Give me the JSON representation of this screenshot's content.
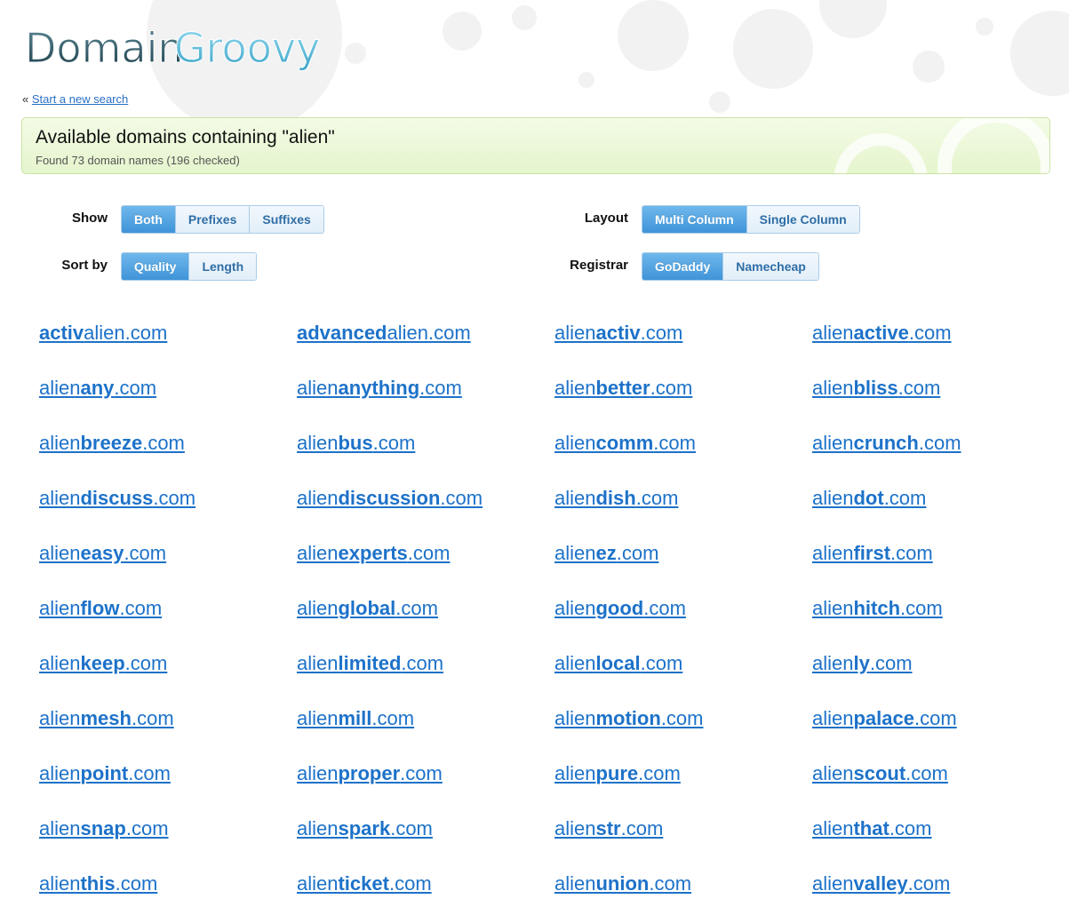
{
  "logo": {
    "text_dark": "Domain",
    "text_light": "Groovy"
  },
  "nav": {
    "back_prefix": "«",
    "back_link": "Start a new search"
  },
  "banner": {
    "title": "Available domains containing \"alien\"",
    "subtitle": "Found 73 domain names (196 checked)"
  },
  "controls": {
    "show": {
      "label": "Show",
      "options": [
        "Both",
        "Prefixes",
        "Suffixes"
      ],
      "selected": "Both"
    },
    "sort": {
      "label": "Sort by",
      "options": [
        "Quality",
        "Length"
      ],
      "selected": "Quality"
    },
    "layout": {
      "label": "Layout",
      "options": [
        "Multi Column",
        "Single Column"
      ],
      "selected": "Multi Column"
    },
    "registrar": {
      "label": "Registrar",
      "options": [
        "GoDaddy",
        "Namecheap"
      ],
      "selected": "GoDaddy"
    }
  },
  "domains": [
    {
      "pre": "activ",
      "kw": "alien",
      "post": "",
      "tld": ".com",
      "bold": "pre"
    },
    {
      "pre": "advanced",
      "kw": "alien",
      "post": "",
      "tld": ".com",
      "bold": "pre"
    },
    {
      "pre": "",
      "kw": "alien",
      "post": "activ",
      "tld": ".com",
      "bold": "post"
    },
    {
      "pre": "",
      "kw": "alien",
      "post": "active",
      "tld": ".com",
      "bold": "post"
    },
    {
      "pre": "",
      "kw": "alien",
      "post": "any",
      "tld": ".com",
      "bold": "post"
    },
    {
      "pre": "",
      "kw": "alien",
      "post": "anything",
      "tld": ".com",
      "bold": "post"
    },
    {
      "pre": "",
      "kw": "alien",
      "post": "better",
      "tld": ".com",
      "bold": "post"
    },
    {
      "pre": "",
      "kw": "alien",
      "post": "bliss",
      "tld": ".com",
      "bold": "post"
    },
    {
      "pre": "",
      "kw": "alien",
      "post": "breeze",
      "tld": ".com",
      "bold": "post"
    },
    {
      "pre": "",
      "kw": "alien",
      "post": "bus",
      "tld": ".com",
      "bold": "post"
    },
    {
      "pre": "",
      "kw": "alien",
      "post": "comm",
      "tld": ".com",
      "bold": "post"
    },
    {
      "pre": "",
      "kw": "alien",
      "post": "crunch",
      "tld": ".com",
      "bold": "post"
    },
    {
      "pre": "",
      "kw": "alien",
      "post": "discuss",
      "tld": ".com",
      "bold": "post"
    },
    {
      "pre": "",
      "kw": "alien",
      "post": "discussion",
      "tld": ".com",
      "bold": "post"
    },
    {
      "pre": "",
      "kw": "alien",
      "post": "dish",
      "tld": ".com",
      "bold": "post"
    },
    {
      "pre": "",
      "kw": "alien",
      "post": "dot",
      "tld": ".com",
      "bold": "post"
    },
    {
      "pre": "",
      "kw": "alien",
      "post": "easy",
      "tld": ".com",
      "bold": "post"
    },
    {
      "pre": "",
      "kw": "alien",
      "post": "experts",
      "tld": ".com",
      "bold": "post"
    },
    {
      "pre": "",
      "kw": "alien",
      "post": "ez",
      "tld": ".com",
      "bold": "post"
    },
    {
      "pre": "",
      "kw": "alien",
      "post": "first",
      "tld": ".com",
      "bold": "post"
    },
    {
      "pre": "",
      "kw": "alien",
      "post": "flow",
      "tld": ".com",
      "bold": "post"
    },
    {
      "pre": "",
      "kw": "alien",
      "post": "global",
      "tld": ".com",
      "bold": "post"
    },
    {
      "pre": "",
      "kw": "alien",
      "post": "good",
      "tld": ".com",
      "bold": "post"
    },
    {
      "pre": "",
      "kw": "alien",
      "post": "hitch",
      "tld": ".com",
      "bold": "post"
    },
    {
      "pre": "",
      "kw": "alien",
      "post": "keep",
      "tld": ".com",
      "bold": "post"
    },
    {
      "pre": "",
      "kw": "alien",
      "post": "limited",
      "tld": ".com",
      "bold": "post"
    },
    {
      "pre": "",
      "kw": "alien",
      "post": "local",
      "tld": ".com",
      "bold": "post"
    },
    {
      "pre": "",
      "kw": "alien",
      "post": "ly",
      "tld": ".com",
      "bold": "post"
    },
    {
      "pre": "",
      "kw": "alien",
      "post": "mesh",
      "tld": ".com",
      "bold": "post"
    },
    {
      "pre": "",
      "kw": "alien",
      "post": "mill",
      "tld": ".com",
      "bold": "post"
    },
    {
      "pre": "",
      "kw": "alien",
      "post": "motion",
      "tld": ".com",
      "bold": "post"
    },
    {
      "pre": "",
      "kw": "alien",
      "post": "palace",
      "tld": ".com",
      "bold": "post"
    },
    {
      "pre": "",
      "kw": "alien",
      "post": "point",
      "tld": ".com",
      "bold": "post"
    },
    {
      "pre": "",
      "kw": "alien",
      "post": "proper",
      "tld": ".com",
      "bold": "post"
    },
    {
      "pre": "",
      "kw": "alien",
      "post": "pure",
      "tld": ".com",
      "bold": "post"
    },
    {
      "pre": "",
      "kw": "alien",
      "post": "scout",
      "tld": ".com",
      "bold": "post"
    },
    {
      "pre": "",
      "kw": "alien",
      "post": "snap",
      "tld": ".com",
      "bold": "post"
    },
    {
      "pre": "",
      "kw": "alien",
      "post": "spark",
      "tld": ".com",
      "bold": "post"
    },
    {
      "pre": "",
      "kw": "alien",
      "post": "str",
      "tld": ".com",
      "bold": "post"
    },
    {
      "pre": "",
      "kw": "alien",
      "post": "that",
      "tld": ".com",
      "bold": "post"
    },
    {
      "pre": "",
      "kw": "alien",
      "post": "this",
      "tld": ".com",
      "bold": "post"
    },
    {
      "pre": "",
      "kw": "alien",
      "post": "ticket",
      "tld": ".com",
      "bold": "post"
    },
    {
      "pre": "",
      "kw": "alien",
      "post": "union",
      "tld": ".com",
      "bold": "post"
    },
    {
      "pre": "",
      "kw": "alien",
      "post": "valley",
      "tld": ".com",
      "bold": "post"
    }
  ],
  "colors": {
    "link": "#1d72c9",
    "banner_bg": "#e5f5cd",
    "button_active": "#3f94d8",
    "logo_dark": "#2f5b6b",
    "logo_light": "#5ab8d6"
  }
}
